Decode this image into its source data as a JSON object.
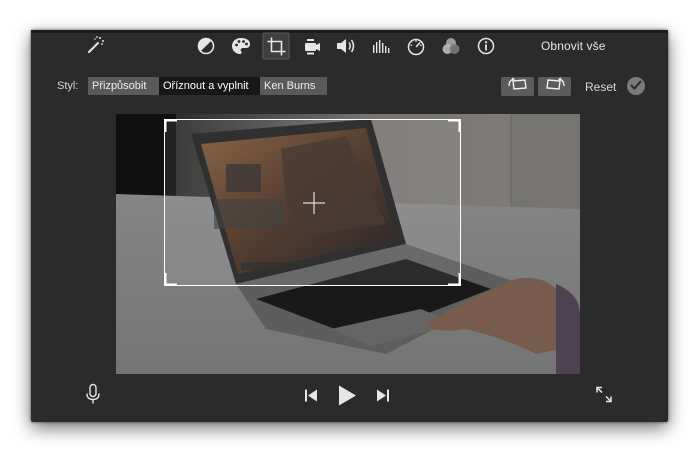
{
  "toolbar": {
    "icons": [
      "magic-wand-icon",
      "color-balance-icon",
      "color-palette-icon",
      "crop-icon",
      "stabilization-icon",
      "volume-icon",
      "equalizer-icon",
      "speed-icon",
      "filter-icon",
      "info-icon"
    ],
    "restore_label": "Obnovit vše"
  },
  "crop_style": {
    "label": "Styl:",
    "options": [
      "Přizpůsobit",
      "Oříznout a vyplnit",
      "Ken Burns"
    ],
    "selected": "Oříznout a vyplnit"
  },
  "actions": {
    "rotate_left_icon": "rotate-left-icon",
    "rotate_right_icon": "rotate-right-icon",
    "reset_label": "Reset",
    "apply_icon": "checkmark-icon"
  },
  "viewer": {
    "content": "laptop-on-desk-frame"
  },
  "playback": {
    "icons": [
      "microphone-icon",
      "skip-back-icon",
      "play-icon",
      "skip-forward-icon",
      "fullscreen-icon"
    ]
  },
  "colors": {
    "window_bg": "#2b2b2b",
    "segment_selected": "#171717",
    "segment_normal": "#5a5a5a",
    "text": "#e6e6e6"
  }
}
